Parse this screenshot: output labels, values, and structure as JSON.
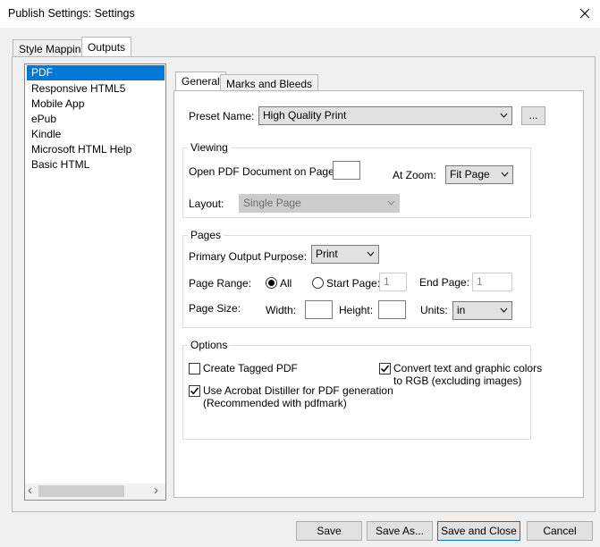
{
  "window": {
    "title": "Publish Settings: Settings",
    "close_glyph": "✕"
  },
  "outer_tabs": [
    {
      "label": "Style Mapping"
    },
    {
      "label": "Outputs"
    }
  ],
  "outputs_list": [
    {
      "label": "PDF"
    },
    {
      "label": "Responsive HTML5"
    },
    {
      "label": "Mobile App"
    },
    {
      "label": "ePub"
    },
    {
      "label": "Kindle"
    },
    {
      "label": "Microsoft HTML Help"
    },
    {
      "label": "Basic HTML"
    }
  ],
  "scroll": {
    "left_glyph": "‹",
    "right_glyph": "›"
  },
  "inner_tabs": [
    {
      "label": "General"
    },
    {
      "label": "Marks and Bleeds"
    }
  ],
  "preset": {
    "label": "Preset Name:",
    "value": "High Quality Print",
    "browse_label": "..."
  },
  "viewing": {
    "title": "Viewing",
    "open_page_label": "Open PDF Document on Page:",
    "open_page_value": "",
    "zoom_label": "At Zoom:",
    "zoom_value": "Fit Page",
    "layout_label": "Layout:",
    "layout_value": "Single Page"
  },
  "pages": {
    "title": "Pages",
    "purpose_label": "Primary Output Purpose:",
    "purpose_value": "Print",
    "range_label": "Page Range:",
    "all_label": "All",
    "start_label": "Start Page:",
    "start_value": "1",
    "end_label": "End Page:",
    "end_value": "1",
    "size_label": "Page Size:",
    "width_label": "Width:",
    "width_value": "",
    "height_label": "Height:",
    "height_value": "",
    "units_label": "Units:",
    "units_value": "in"
  },
  "options": {
    "title": "Options",
    "tagged_label": "Create Tagged PDF",
    "tagged_checked": false,
    "distiller_label": "Use Acrobat Distiller for PDF generation",
    "distiller_note": "(Recommended with pdfmark)",
    "distiller_checked": true,
    "convert_label": "Convert text and graphic colors",
    "convert_note": "to RGB (excluding images)",
    "convert_checked": true
  },
  "buttons": {
    "save": "Save",
    "save_as": "Save As...",
    "save_close": "Save and Close",
    "cancel": "Cancel"
  },
  "colors": {
    "selection": "#0078d7",
    "dialog_bg": "#f0f0f0"
  },
  "icons": {
    "check": "check-icon",
    "dropdown": "chevron-down-icon",
    "close": "close-icon"
  }
}
